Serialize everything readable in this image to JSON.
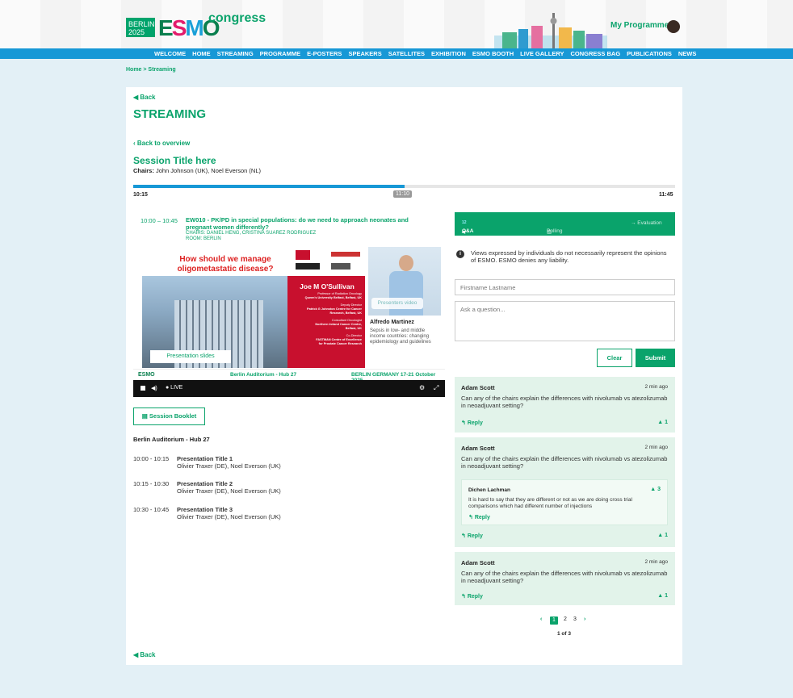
{
  "header": {
    "logo_city": "BERLIN",
    "logo_year": "2025",
    "logo_brand": [
      "E",
      "S",
      "M",
      "O"
    ],
    "logo_suffix": "congress",
    "my_programme": "My Programme ▾"
  },
  "nav": [
    "WELCOME",
    "HOME",
    "STREAMING",
    "PROGRAMME",
    "E-POSTERS",
    "SPEAKERS",
    "SATELLITES",
    "EXHIBITION",
    "ESMO BOOTH",
    "LIVE GALLERY",
    "CONGRESS BAG",
    "PUBLICATIONS",
    "NEWS"
  ],
  "breadcrumb": "Home  >  Streaming",
  "back_top": "Back",
  "page_title": "STREAMING",
  "back_overview": "Back to overview",
  "session": {
    "title": "Session Title here",
    "chairs_label": "Chairs:",
    "chairs": "John Johnson (UK), Noel Everson (NL)",
    "progress": 0.5,
    "time_start": "10:15",
    "time_current": "11:10",
    "time_end": "11:45"
  },
  "talk": {
    "time": "10:00 – 10:45",
    "title": "EW010 - PK/PD in special populations: do we need to approach neonates and pregnant women differently?",
    "chairs": "CHAIRS: DANIEL HENG, CRISTINA SUAREZ RODRIGUEZ",
    "room": "ROOM: BERLIN"
  },
  "slide": {
    "question": "How should we manage oligometastatic disease?",
    "speaker": "Joe M O'Sullivan",
    "lines": [
      "Professor of Radiation Oncology",
      "Queen's University Belfast, Belfast, UK",
      "Deputy Director",
      "Patrick G Johnston Centre for Cancer",
      "Research, Belfast, UK",
      "Consultant Oncologist",
      "Northern Ireland Cancer Centre,",
      "Belfast, UK",
      "Co-Director",
      "FASTMAN Centre of Excellence",
      "for Prostate Cancer Research"
    ],
    "presentation_btn": "Presentation slides"
  },
  "presenter": {
    "video_btn": "Presenters video",
    "name": "Alfredo Martinez",
    "desc": "Sepsis in low- and middle income countries: changing epidemiology and guidelines"
  },
  "strip": {
    "venue": "Berlin Auditorium - Hub 27",
    "city": "BERLIN",
    "country_dates": " GERMANY 17-21 October 2025"
  },
  "controls": {
    "live": "● LIVE"
  },
  "booklet": "Session Booklet",
  "room_name": "Berlin Auditorium - Hub 27",
  "presentations": [
    {
      "time": "10:00 - 10:15",
      "title": "Presentation Title 1",
      "chairs": "Olivier Traxer (DE), Noel Everson (UK)"
    },
    {
      "time": "10:15 - 10:30",
      "title": "Presentation Title 2",
      "chairs": "Olivier Traxer (DE), Noel Everson (UK)"
    },
    {
      "time": "10:30 - 10:45",
      "title": "Presentation Title 3",
      "chairs": "Olivier Traxer (DE), Noel Everson (UK)"
    }
  ],
  "tabs": {
    "qa": "Q&A",
    "qa_count": "12",
    "polling": "Polling",
    "evaluation": "→ Evaluation"
  },
  "disclaimer": "Views expressed by individuals do not necessarily represent the opinions of ESMO. ESMO denies any liability.",
  "form": {
    "name_placeholder": "Firstname Lastname",
    "question_placeholder": "Ask a question...",
    "clear": "Clear",
    "submit": "Submit"
  },
  "questions": [
    {
      "author": "Adam Scott",
      "ago": "2 min ago",
      "text": "Can any of the chairs explain the differences with nivolumab vs atezolizumab in neoadjuvant setting?",
      "reply": "Reply",
      "likes": "1"
    },
    {
      "author": "Adam Scott",
      "ago": "2 min ago",
      "text": "Can any of the chairs explain the differences with nivolumab vs atezolizumab in neoadjuvant setting?",
      "reply": "Reply",
      "likes": "1",
      "answer": {
        "author": "Dichen Lachman",
        "likes": "3",
        "text": "It is hard to say that they are different or not as we are doing cross trial comparisons which had different number of injections",
        "reply": "Reply"
      }
    },
    {
      "author": "Adam Scott",
      "ago": "2 min ago",
      "text": "Can any of the chairs explain the differences with nivolumab vs atezolizumab in neoadjuvant setting?",
      "reply": "Reply",
      "likes": "1"
    }
  ],
  "pagination": {
    "pages": [
      "1",
      "2",
      "3"
    ],
    "current": "1",
    "summary": "1 of 3"
  },
  "back_bottom": "Back"
}
